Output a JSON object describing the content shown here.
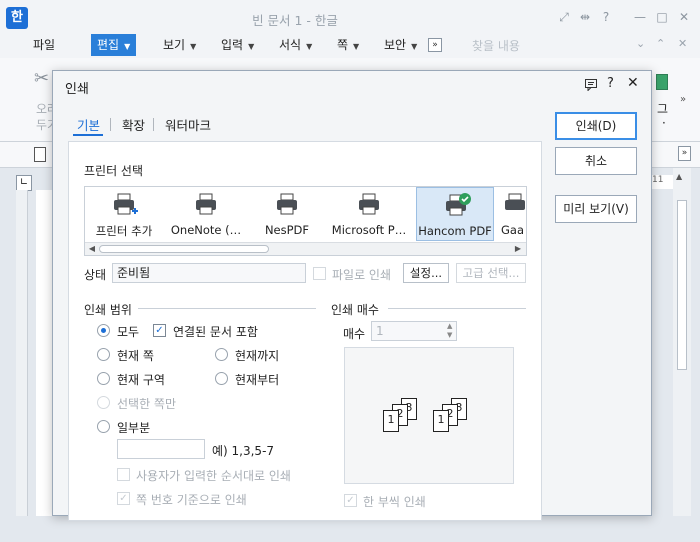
{
  "app": {
    "logo": "한",
    "title": "빈 문서 1 - 한글"
  },
  "window_controls": {
    "icons": [
      "fullscreen-icon",
      "layout-icon",
      "help-icon",
      "minimize-icon",
      "maximize-icon",
      "close-icon"
    ],
    "help": "?"
  },
  "menu": {
    "items": [
      {
        "label": "파일",
        "caret": false
      },
      {
        "label": "편집",
        "caret": true,
        "active": true
      },
      {
        "label": "보기",
        "caret": true
      },
      {
        "label": "입력",
        "caret": true
      },
      {
        "label": "서식",
        "caret": true
      },
      {
        "label": "쪽",
        "caret": true
      },
      {
        "label": "보안",
        "caret": true
      }
    ],
    "search_placeholder": "찾을 내용"
  },
  "toolbar": {
    "cut_label_1": "오려",
    "cut_label_2": "두기",
    "right_label_1": "그",
    "right_label_2": "·"
  },
  "ruler": {
    "mark": "11"
  },
  "dialog": {
    "title": "인쇄",
    "help": "?",
    "close": "✕",
    "tabs": [
      "기본",
      "확장",
      "워터마크"
    ],
    "buttons": {
      "print": "인쇄(D)",
      "cancel": "취소",
      "preview": "미리 보기(V)"
    },
    "printer_section": "프린터 선택",
    "printers": [
      "프린터 추가",
      "OneNote (…",
      "NesPDF",
      "Microsoft P…",
      "Hancom PDF",
      "Gaa"
    ],
    "selected_printer": "Hancom PDF",
    "status_label": "상태",
    "status_value": "준비됨",
    "print_to_file": "파일로 인쇄",
    "settings_button": "설정...",
    "advanced_button": "고급 선택...",
    "range": {
      "title": "인쇄 범위",
      "all": "모두",
      "linked_docs": "연결된 문서 포함",
      "current_page": "현재 쪽",
      "up_to_current": "현재까지",
      "current_section": "현재 구역",
      "from_current": "현재부터",
      "selected_pages": "선택한 쪽만",
      "some": "일부분",
      "example": "예) 1,3,5-7",
      "user_order": "사용자가 입력한 순서대로 인쇄",
      "by_page_number": "쪽 번호 기준으로 인쇄"
    },
    "copies": {
      "title": "인쇄 매수",
      "label": "매수",
      "value": "1",
      "collate": "한 부씩 인쇄"
    }
  }
}
